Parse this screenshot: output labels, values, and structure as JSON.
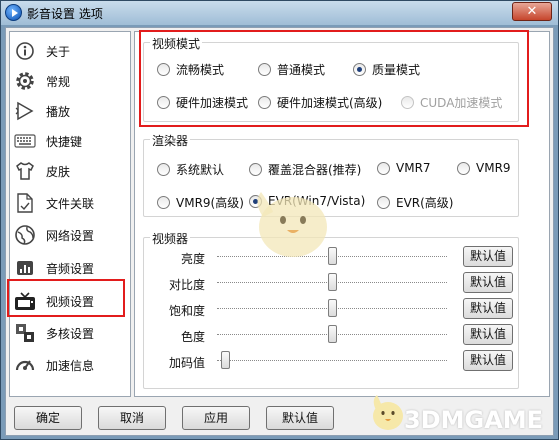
{
  "window": {
    "title": "影音设置 选项",
    "close_glyph": "✕"
  },
  "sidebar": {
    "items": [
      {
        "label": "关于",
        "icon": "info-icon"
      },
      {
        "label": "常规",
        "icon": "gear-icon"
      },
      {
        "label": "播放",
        "icon": "play-icon"
      },
      {
        "label": "快捷键",
        "icon": "keyboard-icon"
      },
      {
        "label": "皮肤",
        "icon": "shirt-icon"
      },
      {
        "label": "文件关联",
        "icon": "file-icon"
      },
      {
        "label": "网络设置",
        "icon": "globe-icon"
      },
      {
        "label": "音频设置",
        "icon": "audio-icon"
      },
      {
        "label": "视频设置",
        "icon": "tv-icon"
      },
      {
        "label": "多核设置",
        "icon": "cpu-icon"
      },
      {
        "label": "加速信息",
        "icon": "speedometer-icon"
      }
    ],
    "selected": "视频设置"
  },
  "video_mode": {
    "legend": "视频模式",
    "options": [
      {
        "label": "流畅模式",
        "checked": false,
        "enabled": true
      },
      {
        "label": "普通模式",
        "checked": false,
        "enabled": true
      },
      {
        "label": "质量模式",
        "checked": true,
        "enabled": true
      },
      {
        "label": "硬件加速模式",
        "checked": false,
        "enabled": true
      },
      {
        "label": "硬件加速模式(高级)",
        "checked": false,
        "enabled": true
      },
      {
        "label": "CUDA加速模式",
        "checked": false,
        "enabled": false
      }
    ]
  },
  "renderer": {
    "legend": "渲染器",
    "options": [
      {
        "label": "系统默认",
        "checked": false
      },
      {
        "label": "覆盖混合器(推荐)",
        "checked": false
      },
      {
        "label": "VMR7",
        "checked": false
      },
      {
        "label": "VMR9",
        "checked": false
      },
      {
        "label": "VMR9(高级)",
        "checked": false
      },
      {
        "label": "EVR(Win7/Vista)",
        "checked": true
      },
      {
        "label": "EVR(高级)",
        "checked": false
      }
    ]
  },
  "adjust": {
    "legend": "视频器",
    "default_label": "默认值",
    "sliders": [
      {
        "label": "亮度",
        "value": 0.5
      },
      {
        "label": "对比度",
        "value": 0.5
      },
      {
        "label": "饱和度",
        "value": 0.5
      },
      {
        "label": "色度",
        "value": 0.5
      },
      {
        "label": "加码值",
        "value": 0.02
      }
    ]
  },
  "buttons": {
    "ok": "确定",
    "cancel": "取消",
    "apply": "应用",
    "defaults": "默认值"
  },
  "watermark": {
    "text": "3DMGAME"
  },
  "colors": {
    "highlight": "#e21c1c",
    "selected_bg": "#ffffff",
    "radio_dot": "#1f3f7a"
  }
}
